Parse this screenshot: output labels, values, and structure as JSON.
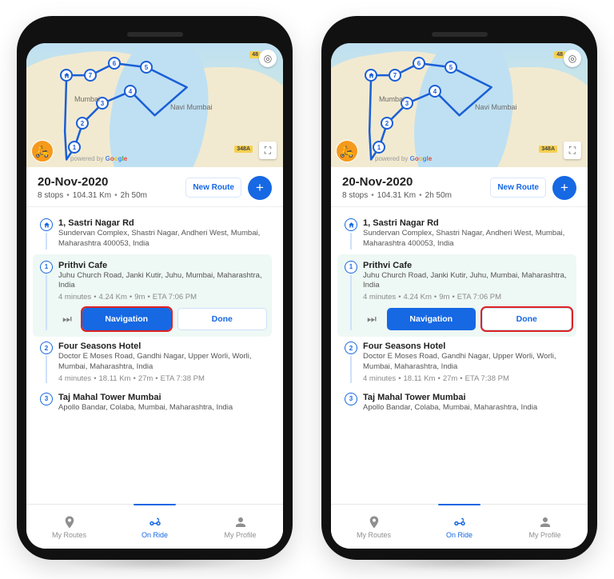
{
  "map": {
    "city1": "Mumbai",
    "city2": "Navi Mumbai",
    "roads": [
      "48",
      "348A"
    ],
    "attribution_prefix": "powered by",
    "pins": [
      "home",
      "7",
      "6",
      "5",
      "4",
      "3",
      "2",
      "1"
    ]
  },
  "header": {
    "date": "20-Nov-2020",
    "stops": "8 stops",
    "distance": "104.31 Km",
    "duration": "2h 50m",
    "new_route": "New Route"
  },
  "stops": [
    {
      "marker": "home",
      "title": "1, Sastri Nagar Rd",
      "addr": "Sundervan Complex, Shastri Nagar, Andheri West, Mumbai, Maharashtra 400053, India"
    },
    {
      "marker": "1",
      "title": "Prithvi Cafe",
      "addr": "Juhu Church Road, Janki Kutir, Juhu, Mumbai, Maharashtra, India",
      "eta": {
        "t": "4 minutes",
        "d": "4.24 Km",
        "dur": "9m",
        "eta": "ETA 7:06 PM"
      },
      "actions": {
        "nav": "Navigation",
        "done": "Done"
      }
    },
    {
      "marker": "2",
      "title": "Four Seasons Hotel",
      "addr": "Doctor E Moses Road, Gandhi Nagar, Upper Worli, Worli, Mumbai, Maharashtra, India",
      "eta": {
        "t": "4 minutes",
        "d": "18.11 Km",
        "dur": "27m",
        "eta": "ETA 7:38 PM"
      }
    },
    {
      "marker": "3",
      "title": "Taj Mahal Tower Mumbai",
      "addr": "Apollo Bandar, Colaba, Mumbai, Maharashtra, India"
    }
  ],
  "nav": {
    "routes": "My Routes",
    "ride": "On Ride",
    "profile": "My Profile"
  },
  "phones": [
    {
      "highlight": "nav"
    },
    {
      "highlight": "done"
    }
  ]
}
